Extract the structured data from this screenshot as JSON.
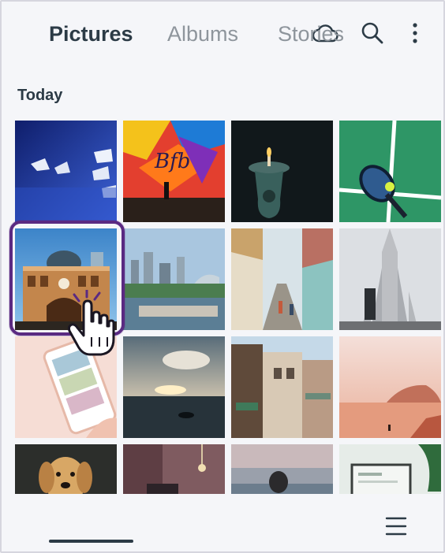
{
  "header": {
    "icons": [
      "cloud-icon",
      "search-icon",
      "more-vertical-icon"
    ]
  },
  "section": {
    "title": "Today"
  },
  "photos": [
    "paper-boats",
    "graffiti-wall",
    "candle",
    "tennis-racket",
    "flinders-street-station",
    "city-waterfront",
    "colorful-street",
    "hallgrimskirkja-church",
    "phone-gallery",
    "sea-sunset",
    "old-buildings",
    "desert-rocks",
    "dog",
    "interior-room",
    "beach-person",
    "laptop-desk"
  ],
  "selected_photo": "flinders-street-station",
  "tabs": {
    "pictures": "Pictures",
    "albums": "Albums",
    "stories": "Stories",
    "active": "pictures"
  },
  "menu_icon": "hamburger-menu-icon",
  "colors": {
    "accent": "#5a2a82",
    "text_dark": "#2c3b46",
    "text_muted": "#8e959c",
    "background": "#f5f6f9"
  }
}
